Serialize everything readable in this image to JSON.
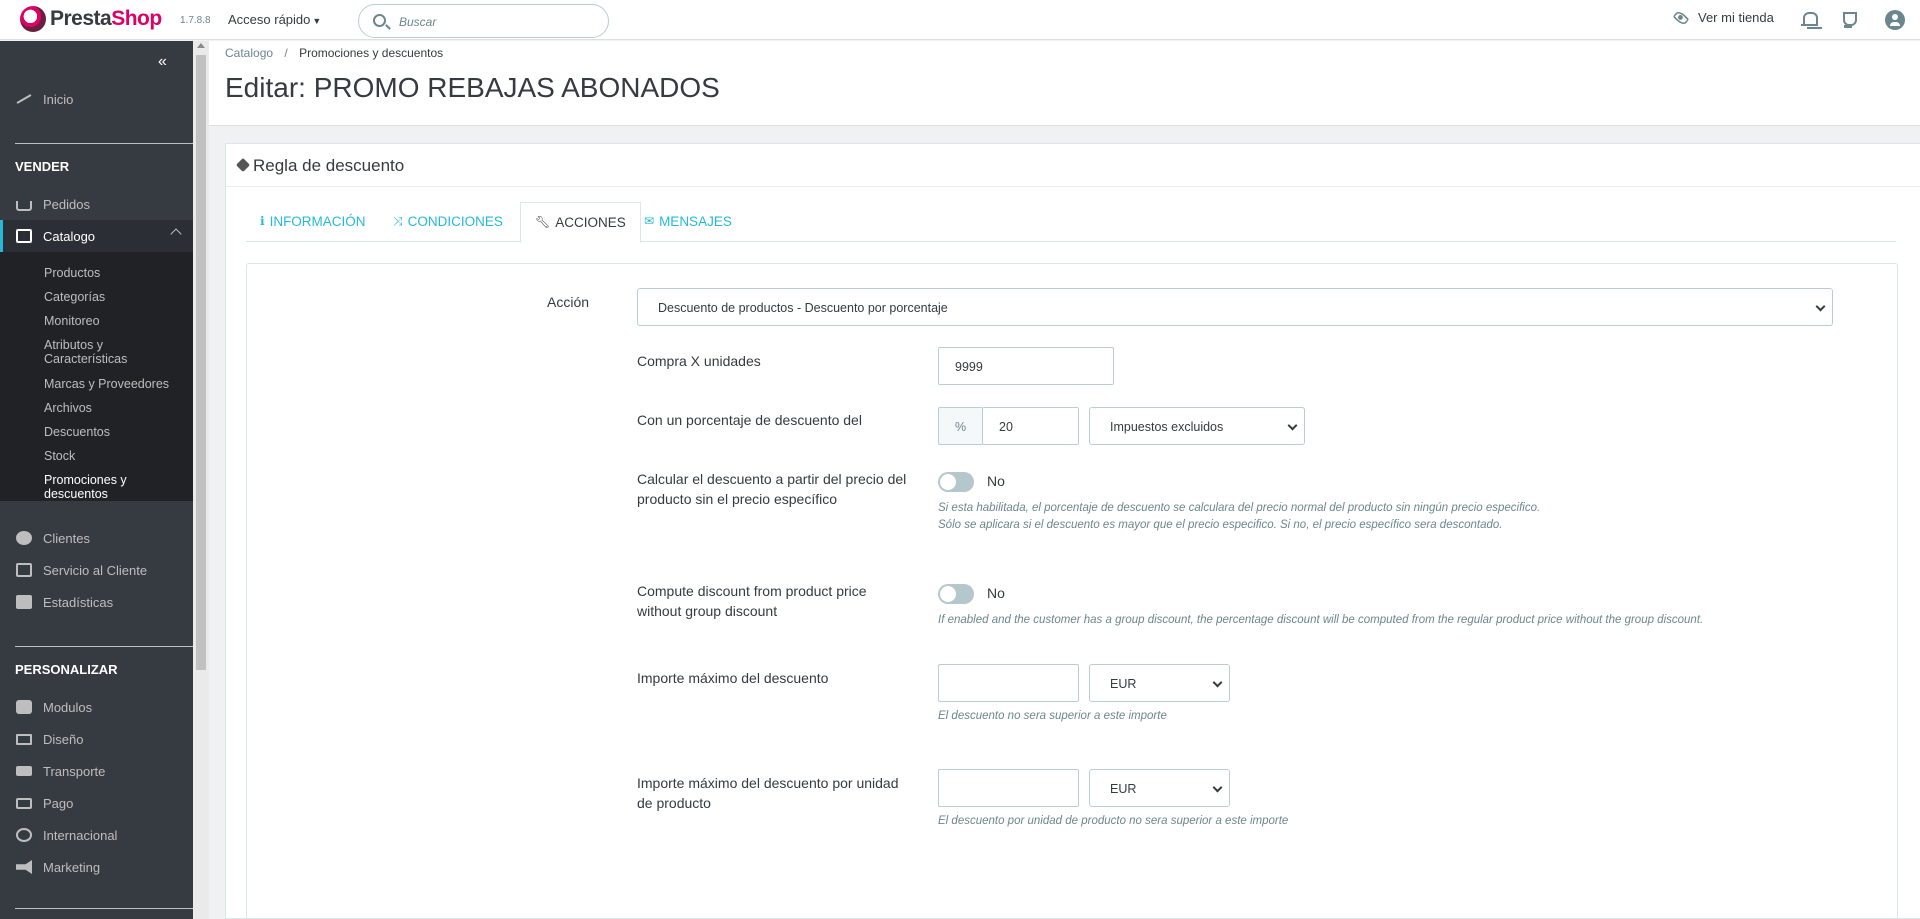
{
  "header": {
    "brand_prefix": "Presta",
    "brand_suffix": "Shop",
    "version": "1.7.8.8",
    "quick_access": "Acceso rápido",
    "search_placeholder": "Buscar",
    "view_store": "Ver mi tienda"
  },
  "sidebar": {
    "home": "Inicio",
    "section_sell": "VENDER",
    "orders": "Pedidos",
    "catalog": "Catalogo",
    "catalog_items": [
      "Productos",
      "Categorías",
      "Monitoreo",
      "Atributos y Características",
      "Marcas y Proveedores",
      "Archivos",
      "Descuentos",
      "Stock",
      "Promociones y descuentos"
    ],
    "customers": "Clientes",
    "customer_service": "Servicio al Cliente",
    "stats": "Estadísticas",
    "section_customize": "PERSONALIZAR",
    "modules": "Modulos",
    "design": "Diseño",
    "shipping": "Transporte",
    "payment": "Pago",
    "international": "Internacional",
    "marketing": "Marketing"
  },
  "page": {
    "breadcrumb_parent": "Catalogo",
    "breadcrumb_sep": "/",
    "breadcrumb_current": "Promociones y descuentos",
    "title": "Editar: PROMO REBAJAS ABONADOS"
  },
  "panel": {
    "title": "Regla de descuento",
    "tabs": [
      {
        "label": "INFORMACIÓN",
        "icon": "info-icon"
      },
      {
        "label": "CONDICIONES",
        "icon": "shuffle-icon"
      },
      {
        "label": "ACCIONES",
        "icon": "wrench-icon"
      },
      {
        "label": "MENSAJES",
        "icon": "envelope-icon"
      }
    ],
    "active_tab": "ACCIONES"
  },
  "form": {
    "action_label": "Acción",
    "action_value": "Descuento de productos - Descuento por porcentaje",
    "buy_units_label": "Compra X unidades",
    "buy_units_value": "9999",
    "percent_label": "Con un porcentaje de descuento del",
    "percent_addon": "%",
    "percent_value": "20",
    "tax_value": "Impuestos excluidos",
    "calc_label": "Calcular el descuento a partir del precio del producto sin el precio específico",
    "calc_toggle": "No",
    "calc_help_1": "Si esta habilitada, el porcentaje de descuento se calculara del precio normal del producto sin ningún precio especifico.",
    "calc_help_2": "Sólo se aplicara si el descuento es mayor que el precio especifico. Si no, el precio específico sera descontado.",
    "group_label": "Compute discount from product price without group discount",
    "group_toggle": "No",
    "group_help": "If enabled and the customer has a group discount, the percentage discount will be computed from the regular product price without the group discount.",
    "max_label": "Importe máximo del descuento",
    "max_currency": "EUR",
    "max_help": "El descuento no sera superior a este importe",
    "max_unit_label": "Importe máximo del descuento por unidad de producto",
    "max_unit_currency": "EUR",
    "max_unit_help": "El descuento por unidad de producto no sera superior a este importe"
  },
  "colors": {
    "accent": "#25b9d7",
    "brand": "#df0067",
    "sidebar": "#363a41"
  }
}
